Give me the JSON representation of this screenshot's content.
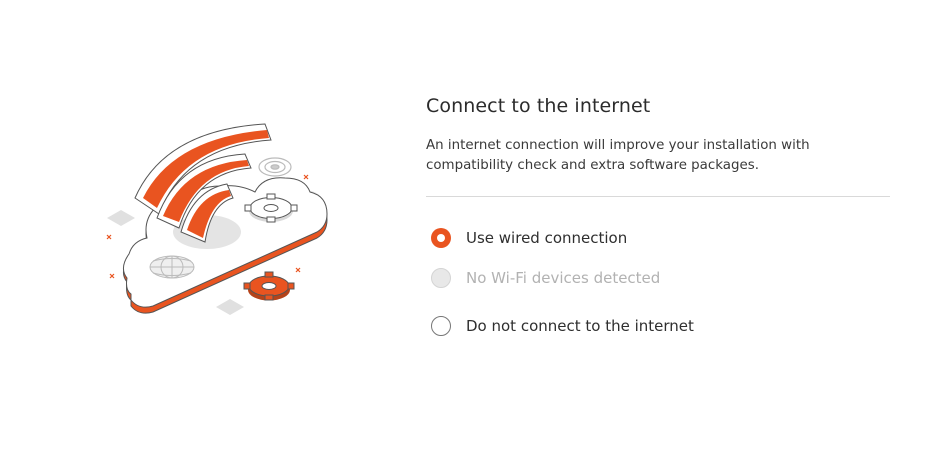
{
  "page": {
    "title": "Connect to the internet",
    "description": "An internet connection will improve your installation with compatibility check and extra software packages."
  },
  "options": [
    {
      "label": "Use wired connection",
      "state": "selected",
      "enabled": true
    },
    {
      "label": "No Wi-Fi devices detected",
      "state": "unselected",
      "enabled": false
    },
    {
      "label": "Do not connect to the internet",
      "state": "unselected",
      "enabled": true
    }
  ],
  "colors": {
    "accent": "#E95420",
    "disabled_text": "#B2B2B2",
    "divider": "#D9D9D9"
  },
  "illustration": {
    "icons": [
      "wifi-icon",
      "cloud-icon",
      "gear-icon",
      "globe-icon",
      "target-icon"
    ]
  }
}
